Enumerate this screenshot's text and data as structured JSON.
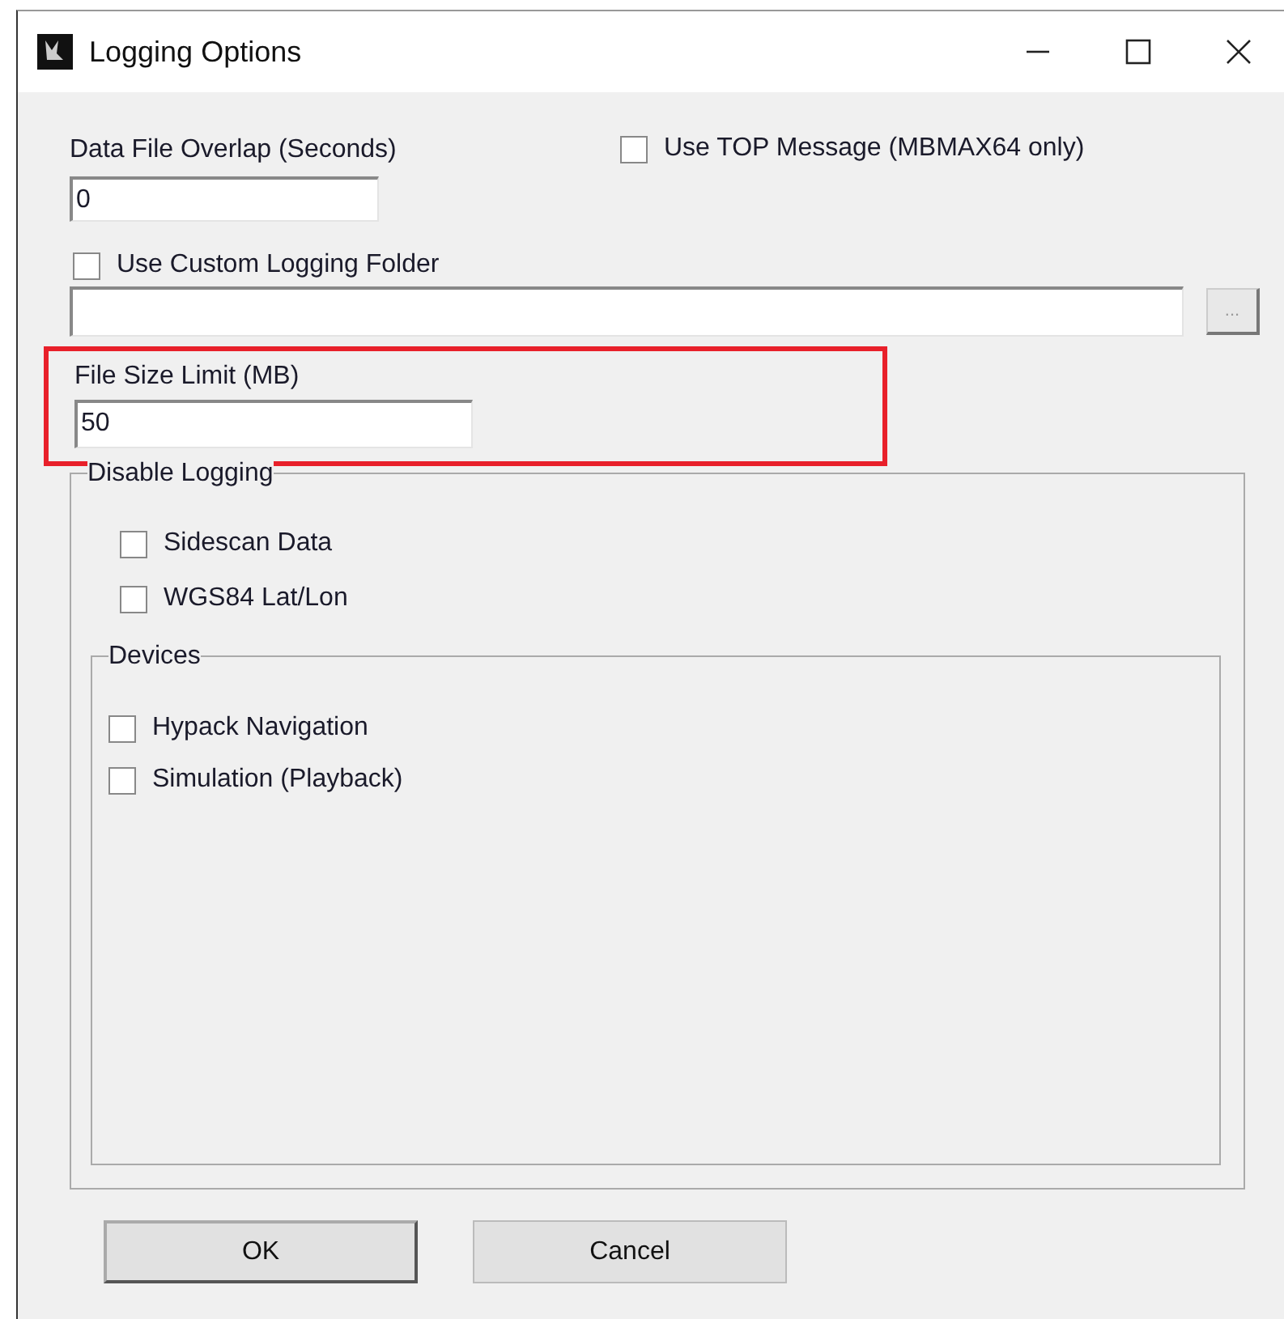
{
  "window": {
    "title": "Logging Options"
  },
  "overlap": {
    "label": "Data File Overlap (Seconds)",
    "value": "0"
  },
  "top_message": {
    "label": "Use TOP Message (MBMAX64 only)",
    "checked": false
  },
  "custom_folder": {
    "label": "Use Custom Logging Folder",
    "checked": false,
    "browse": "..."
  },
  "file_size": {
    "label": "File Size Limit (MB)",
    "value": "50",
    "highlighted": true
  },
  "disable_logging": {
    "title": "Disable Logging",
    "items": [
      {
        "label": "Sidescan Data",
        "checked": false
      },
      {
        "label": "WGS84 Lat/Lon",
        "checked": false
      }
    ],
    "devices": {
      "title": "Devices",
      "items": [
        {
          "label": "Hypack Navigation",
          "checked": false
        },
        {
          "label": "Simulation (Playback)",
          "checked": false
        }
      ]
    }
  },
  "buttons": [
    {
      "label": "OK",
      "default": true
    },
    {
      "label": "Cancel",
      "default": false
    }
  ]
}
